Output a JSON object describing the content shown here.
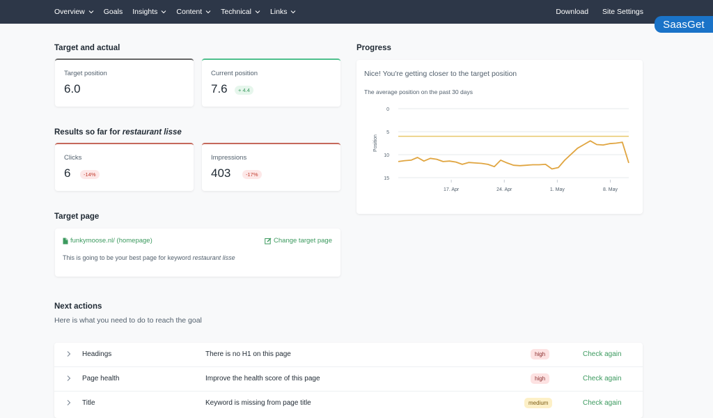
{
  "nav": {
    "left": [
      "Overview",
      "Goals",
      "Insights",
      "Content",
      "Technical",
      "Links"
    ],
    "right": [
      "Download",
      "Site Settings"
    ]
  },
  "watermark": "SaasGet",
  "target_actual": {
    "title": "Target and actual",
    "target_label": "Target position",
    "target_value": "6.0",
    "current_label": "Current position",
    "current_value": "7.6",
    "current_delta": "+ 4.4"
  },
  "results": {
    "title_prefix": "Results so far for",
    "keyword": "restaurant lisse",
    "clicks_label": "Clicks",
    "clicks_value": "6",
    "clicks_delta": "-14%",
    "impressions_label": "Impressions",
    "impressions_value": "403",
    "impressions_delta": "-17%"
  },
  "target_page": {
    "title": "Target page",
    "link": "funkymoose.nl/ (homepage)",
    "change_label": "Change target page",
    "desc_prefix": "This is going to be your best page for keyword",
    "desc_keyword": "restaurant lisse"
  },
  "progress": {
    "title": "Progress",
    "headline": "Nice! You're getting closer to the target position",
    "subtitle": "The average position on the past 30 days"
  },
  "chart_data": {
    "type": "line",
    "ylabel": "Position",
    "xlabel": "",
    "y_inverted": true,
    "ylim": [
      0,
      15
    ],
    "yticks": [
      "0",
      "5",
      "10",
      "15"
    ],
    "xticks": [
      "17. Apr",
      "24. Apr",
      "1. May",
      "8. May"
    ],
    "target_line": 6.0,
    "colors": {
      "line": "#e0a540",
      "target": "#e8c76a"
    },
    "series": [
      {
        "values": [
          11.5,
          11.3,
          11.2,
          10.6,
          11.4,
          10.8,
          11.0,
          11.5,
          11.4,
          11.6,
          12.1,
          11.7,
          11.8,
          11.9,
          12.1,
          12.6,
          11.2,
          11.8,
          12.3,
          12.4,
          12.3,
          12.2,
          12.2,
          12.1,
          13.1,
          12.8,
          11.2,
          9.9,
          8.6,
          7.8,
          7.0,
          7.8,
          7.9,
          7.6,
          7.5,
          7.3,
          11.8
        ]
      }
    ]
  },
  "next_actions": {
    "title": "Next actions",
    "subtitle": "Here is what you need to do to reach the goal",
    "rows": [
      {
        "name": "Headings",
        "desc": "There is no H1 on this page",
        "priority": "high",
        "action": "Check again"
      },
      {
        "name": "Page health",
        "desc": "Improve the health score of this page",
        "priority": "high",
        "action": "Check again"
      },
      {
        "name": "Title",
        "desc": "Keyword is missing from page title",
        "priority": "medium",
        "action": "Check again"
      }
    ]
  }
}
